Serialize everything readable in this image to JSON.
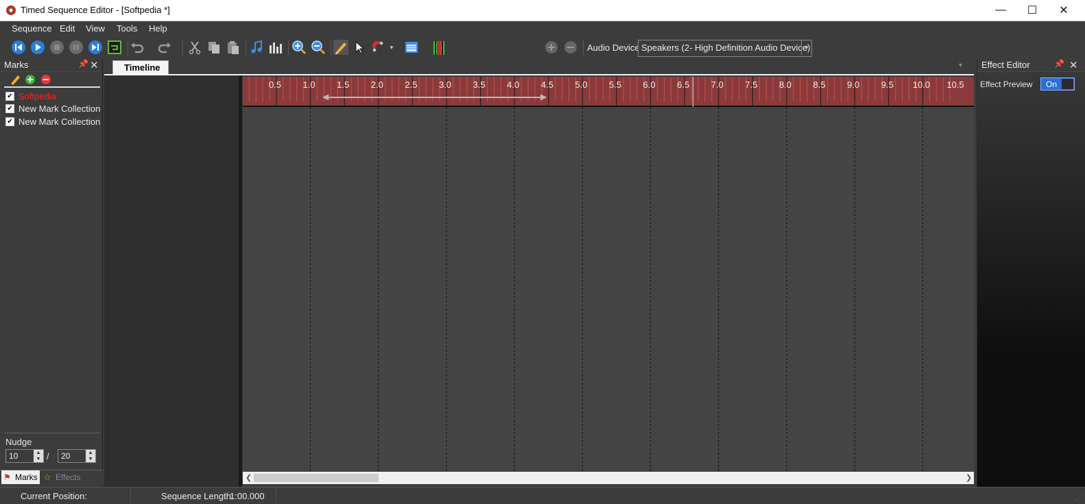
{
  "window": {
    "title": "Timed Sequence Editor - [Softpedia *]",
    "controls": {
      "minimize": "—",
      "maximize": "☐",
      "close": "✕"
    }
  },
  "menu": [
    "Sequence",
    "Edit",
    "View",
    "Tools",
    "Help"
  ],
  "toolbar": {
    "audio_device_label": "Audio Device",
    "audio_device_value": "Speakers (2- High Definition Audio Device)"
  },
  "marks_panel": {
    "title": "Marks",
    "items": [
      {
        "label": "Softpedia",
        "checked": true,
        "color": "#ff2020"
      },
      {
        "label": "New Mark Collection",
        "checked": true
      },
      {
        "label": "New Mark Collection",
        "checked": true
      }
    ],
    "nudge_label": "Nudge",
    "nudge_value_1": "10",
    "nudge_separator": "/",
    "nudge_value_2": "20",
    "bottom_tabs": [
      "Marks",
      "Effects"
    ]
  },
  "timeline": {
    "tab_label": "Timeline",
    "ruler_ticks": [
      "0.5",
      "1.0",
      "1.5",
      "2.0",
      "2.5",
      "3.0",
      "3.5",
      "4.0",
      "4.5",
      "5.0",
      "5.5",
      "6.0",
      "6.5",
      "7.0",
      "7.5",
      "8.0",
      "8.5",
      "9.0",
      "9.5",
      "10.0",
      "10.5"
    ]
  },
  "effect_editor": {
    "title": "Effect Editor",
    "preview_label": "Effect Preview",
    "preview_toggle": "On"
  },
  "status": {
    "current_position_label": "Current Position:",
    "current_position_value": "",
    "sequence_length_label": "Sequence Length:",
    "sequence_length_value": "1:00.000"
  },
  "colors": {
    "accent": "#2a6fd6",
    "ruler": "#8a3a3a",
    "background": "#3c3c3c",
    "grid": "#444444"
  }
}
